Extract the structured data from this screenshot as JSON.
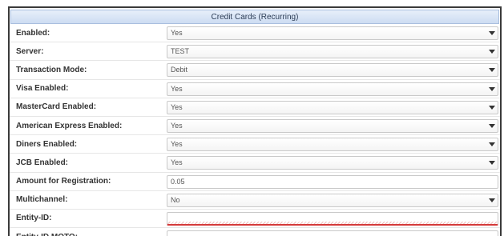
{
  "section": {
    "title": "Credit Cards (Recurring)"
  },
  "rows": [
    {
      "label": "Enabled:",
      "type": "select",
      "value": "Yes"
    },
    {
      "label": "Server:",
      "type": "select",
      "value": "TEST"
    },
    {
      "label": "Transaction Mode:",
      "type": "select",
      "value": "Debit"
    },
    {
      "label": "Visa Enabled:",
      "type": "select",
      "value": "Yes"
    },
    {
      "label": "MasterCard Enabled:",
      "type": "select",
      "value": "Yes"
    },
    {
      "label": "American Express Enabled:",
      "type": "select",
      "value": "Yes"
    },
    {
      "label": "Diners Enabled:",
      "type": "select",
      "value": "Yes"
    },
    {
      "label": "JCB Enabled:",
      "type": "select",
      "value": "Yes"
    },
    {
      "label": "Amount for Registration:",
      "type": "input",
      "value": "0.05"
    },
    {
      "label": "Multichannel:",
      "type": "select",
      "value": "No"
    },
    {
      "label": "Entity-ID:",
      "type": "input",
      "value": ""
    },
    {
      "label": "Entity-ID MOTO:",
      "type": "input",
      "value": ""
    }
  ],
  "colors": {
    "invalid": "#d43a3a",
    "header_bg": "#cddcf2"
  },
  "icons": {
    "dropdown": "chevron-down-icon"
  }
}
